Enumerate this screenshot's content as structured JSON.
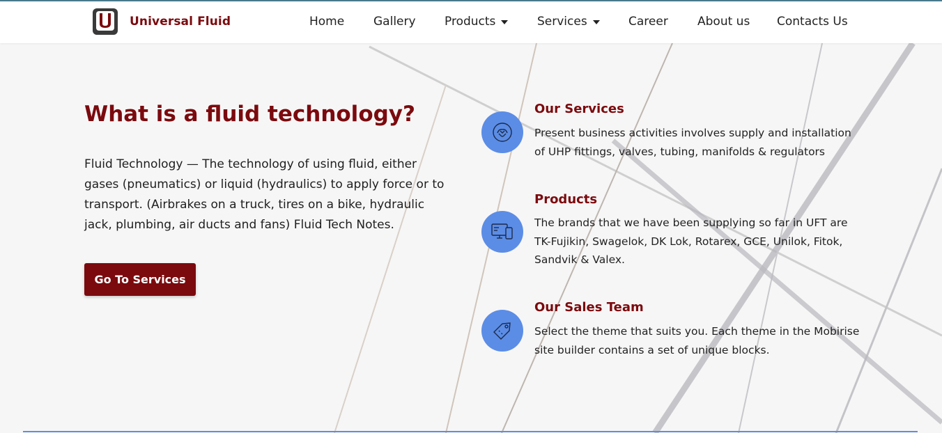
{
  "header": {
    "brand_name": "Universal Fluid",
    "logo_letter": "U",
    "nav": [
      {
        "label": "Home",
        "has_dropdown": false
      },
      {
        "label": "Gallery",
        "has_dropdown": false
      },
      {
        "label": "Products",
        "has_dropdown": true
      },
      {
        "label": "Services",
        "has_dropdown": true
      },
      {
        "label": "Career",
        "has_dropdown": false
      },
      {
        "label": "About us",
        "has_dropdown": false
      },
      {
        "label": "Contacts Us",
        "has_dropdown": false
      }
    ]
  },
  "hero": {
    "heading": "What is a fluid technology?",
    "description": "Fluid Technology — The technology of using fluid, either gases (pneumatics) or liquid (hydraulics) to apply force or to transport. (Airbrakes on a truck, tires on a bike, hydraulic jack, plumbing, air ducts and fans) Fluid Tech Notes.",
    "button_label": "Go To Services"
  },
  "features": [
    {
      "title": "Our Services",
      "text": "Present business activities involves supply and installation of UHP fittings, valves, tubing, manifolds & regulators",
      "icon": "handshake-icon"
    },
    {
      "title": "Products",
      "text": "The brands that we have been supplying so far in UFT are TK-Fujikin, Swagelok, DK Lok, Rotarex, GCE, Unilok, Fitok, Sandvik & Valex.",
      "icon": "devices-icon"
    },
    {
      "title": "Our Sales Team",
      "text": "Select the theme that suits you. Each theme in the Mobirise site builder contains a set of unique blocks.",
      "icon": "price-tag-icon"
    }
  ],
  "colors": {
    "brand": "#7b0a0e",
    "accent": "#5b8de6",
    "background": "#f7f6f6"
  }
}
